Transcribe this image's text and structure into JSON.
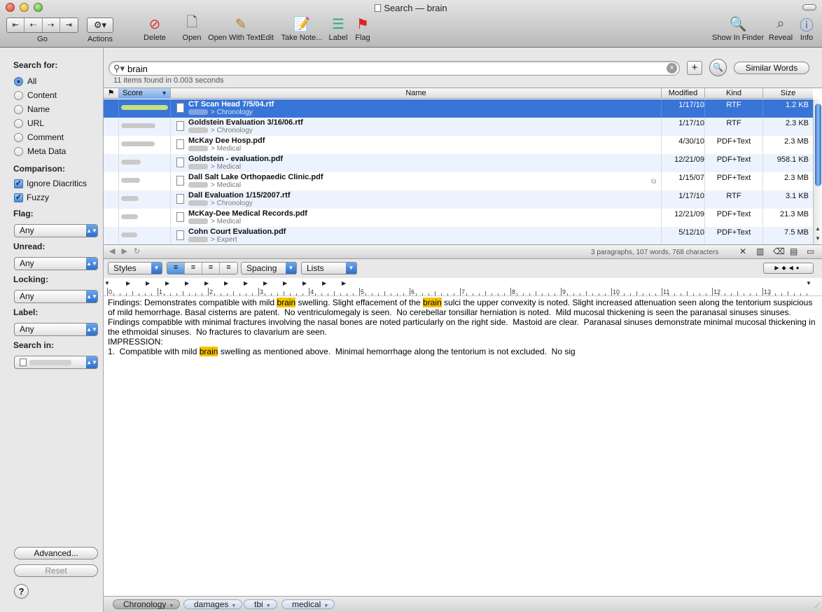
{
  "window": {
    "title": "Search — brain"
  },
  "toolbar": {
    "go_label": "Go",
    "actions_label": "Actions",
    "delete_label": "Delete",
    "open_label": "Open",
    "open_textedit_label": "Open With TextEdit",
    "take_note_label": "Take Note...",
    "label_label": "Label",
    "flag_label": "Flag",
    "show_finder_label": "Show In Finder",
    "reveal_label": "Reveal",
    "info_label": "Info"
  },
  "sidebar": {
    "search_for_label": "Search for:",
    "search_for_options": [
      "All",
      "Content",
      "Name",
      "URL",
      "Comment",
      "Meta Data"
    ],
    "search_for_selected": "All",
    "comparison_label": "Comparison:",
    "ignore_diacritics_label": "Ignore Diacritics",
    "fuzzy_label": "Fuzzy",
    "flag_label": "Flag:",
    "flag_value": "Any",
    "unread_label": "Unread:",
    "unread_value": "Any",
    "locking_label": "Locking:",
    "locking_value": "Any",
    "label_label": "Label:",
    "label_value": "Any",
    "search_in_label": "Search in:",
    "advanced_label": "Advanced...",
    "reset_label": "Reset",
    "help_label": "?"
  },
  "search": {
    "query": "brain",
    "status": "11 items found in 0.003 seconds",
    "similar_words_label": "Similar Words"
  },
  "table": {
    "columns": {
      "score": "Score",
      "name": "Name",
      "modified": "Modified",
      "kind": "Kind",
      "size": "Size"
    },
    "rows": [
      {
        "name": "CT Scan Head 7/5/04.rtf",
        "path": "> Chronology",
        "modified": "1/17/10",
        "kind": "RTF",
        "size": "1.2 KB",
        "score": 0.95
      },
      {
        "name": "Goldstein Evaluation 3/16/06.rtf",
        "path": "> Chronology",
        "modified": "1/17/10",
        "kind": "RTF",
        "size": "2.3 KB",
        "score": 0.7
      },
      {
        "name": "McKay Dee Hosp.pdf",
        "path": "> Medical",
        "modified": "4/30/10",
        "kind": "PDF+Text",
        "size": "2.3 MB",
        "score": 0.68
      },
      {
        "name": "Goldstein - evaluation.pdf",
        "path": "> Medical",
        "modified": "12/21/09",
        "kind": "PDF+Text",
        "size": "958.1 KB",
        "score": 0.4
      },
      {
        "name": "Dall Salt Lake Orthopaedic Clinic.pdf",
        "path": "> Medical",
        "modified": "1/15/07",
        "kind": "PDF+Text",
        "size": "2.3 MB",
        "score": 0.38
      },
      {
        "name": "Dall Evaluation 1/15/2007.rtf",
        "path": "> Chronology",
        "modified": "1/17/10",
        "kind": "RTF",
        "size": "3.1 KB",
        "score": 0.36
      },
      {
        "name": "McKay-Dee Medical Records.pdf",
        "path": "> Medical",
        "modified": "12/21/09",
        "kind": "PDF+Text",
        "size": "21.3 MB",
        "score": 0.34
      },
      {
        "name": "Cohn Court Evaluation.pdf",
        "path": "> Expert",
        "modified": "5/12/10",
        "kind": "PDF+Text",
        "size": "7.5 MB",
        "score": 0.33
      }
    ]
  },
  "status_bar": {
    "stats": "3 paragraphs, 107 words, 768 characters"
  },
  "format_bar": {
    "styles_label": "Styles",
    "spacing_label": "Spacing",
    "lists_label": "Lists"
  },
  "ruler": {
    "numbers": [
      "0",
      "1",
      "2",
      "3",
      "4",
      "5",
      "6",
      "7",
      "8",
      "9",
      "10",
      "11",
      "12",
      "13"
    ]
  },
  "document": {
    "p1": [
      "Findings: Demonstrates compatible with mild ",
      "brain",
      " swelling. Slight effacement of the ",
      "brain",
      " sulci the upper convexity is noted. Slight increased attenuation seen along the tentorium suspicious of mild hemorrhage. Basal cisterns are patent.  No ventriculomegaly is seen.  No cerebellar tonsillar herniation is noted.  Mild mucosal thickening is seen the paranasal sinuses sinuses.  Findings compatible with minimal fractures involving the nasal bones are noted particularly on the right side.  Mastoid are clear.  Paranasal sinuses demonstrate minimal mucosal thickening in the ethmoidal sinuses.  No fractures to clavarium are seen."
    ],
    "p2": "IMPRESSION:",
    "p3": [
      "1.  Compatible with mild ",
      "brain",
      " swelling as mentioned above.  Minimal hemorrhage along the tentorium is not excluded.  No sig"
    ]
  },
  "tags": [
    "Chronology",
    "damages",
    "tbi",
    "medical"
  ],
  "colors": {
    "selection": "#3875d7",
    "highlight": "#f5c400"
  }
}
